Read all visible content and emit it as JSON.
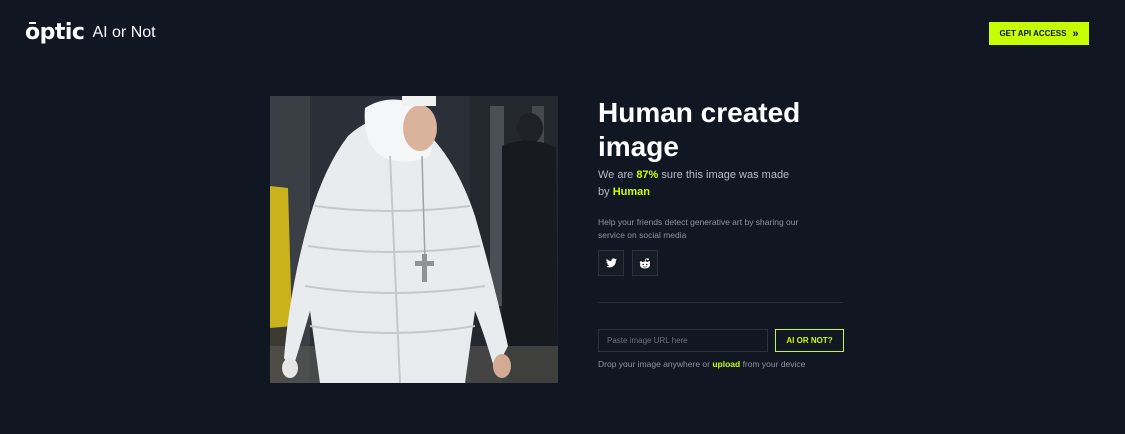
{
  "header": {
    "logo_text": "ōptic",
    "product_name": "AI or Not",
    "api_button_label": "GET API ACCESS",
    "api_button_icon": "double-chevron-right-icon"
  },
  "colors": {
    "background": "#111722",
    "accent": "#c6ff00",
    "muted_text": "#8c939d"
  },
  "result": {
    "title": "Human created image",
    "confidence_prefix": "We are ",
    "confidence_value": "87%",
    "confidence_middle": " sure this image was made by ",
    "verdict": "Human"
  },
  "share": {
    "text": "Help your friends detect generative art by sharing our service on social media",
    "buttons": [
      {
        "icon": "twitter-icon"
      },
      {
        "icon": "reddit-icon"
      }
    ]
  },
  "check": {
    "input_placeholder": "Paste image URL here",
    "button_label": "AI OR NOT?",
    "drop_prefix": "Drop your image anywhere or ",
    "upload_link": "upload",
    "drop_suffix": " from your device"
  }
}
